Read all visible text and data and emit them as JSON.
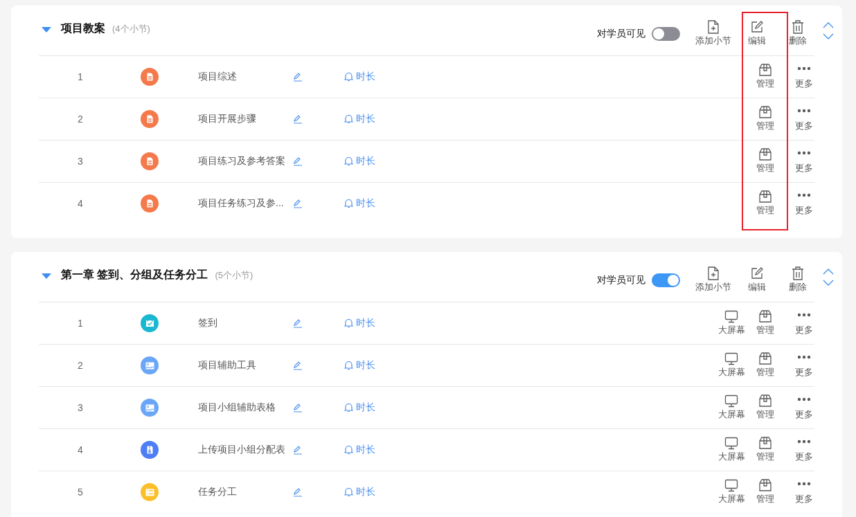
{
  "chapters": [
    {
      "title": "项目教案",
      "count": "(4个小节)",
      "expanded": true,
      "visibility_label": "对学员可见",
      "visible": false,
      "annotation_frame": {
        "color": "#e8212b"
      },
      "actions": [
        {
          "kind": "add",
          "label": "添加小节"
        },
        {
          "kind": "edit",
          "label": "编辑"
        },
        {
          "kind": "delete",
          "label": "删除"
        }
      ],
      "lessons": [
        {
          "number": "1",
          "kind": "document",
          "color": "#f57a4b",
          "title": "项目综述",
          "duration": "时长",
          "actions": [
            {
              "kind": "manage",
              "label": "管理"
            },
            {
              "kind": "more",
              "label": "更多"
            }
          ]
        },
        {
          "number": "2",
          "kind": "document",
          "color": "#f57a4b",
          "title": "项目开展步骤",
          "duration": "时长",
          "actions": [
            {
              "kind": "manage",
              "label": "管理"
            },
            {
              "kind": "more",
              "label": "更多"
            }
          ]
        },
        {
          "number": "3",
          "kind": "document",
          "color": "#f57a4b",
          "title": "项目练习及参考答案",
          "duration": "时长",
          "actions": [
            {
              "kind": "manage",
              "label": "管理"
            },
            {
              "kind": "more",
              "label": "更多"
            }
          ]
        },
        {
          "number": "4",
          "kind": "document",
          "color": "#f57a4b",
          "title": "项目任务练习及参...",
          "duration": "时长",
          "actions": [
            {
              "kind": "manage",
              "label": "管理"
            },
            {
              "kind": "more",
              "label": "更多"
            }
          ]
        }
      ]
    },
    {
      "title": "第一章 签到、分组及任务分工",
      "count": "(5个小节)",
      "expanded": true,
      "visibility_label": "对学员可见",
      "visible": true,
      "actions": [
        {
          "kind": "add",
          "label": "添加小节"
        },
        {
          "kind": "edit",
          "label": "编辑"
        },
        {
          "kind": "delete",
          "label": "删除"
        }
      ],
      "lessons": [
        {
          "number": "1",
          "kind": "checkin",
          "color": "#1ab8d0",
          "title": "签到",
          "duration": "时长",
          "actions": [
            {
              "kind": "screen",
              "label": "大屏幕"
            },
            {
              "kind": "manage",
              "label": "管理"
            },
            {
              "kind": "more",
              "label": "更多"
            }
          ]
        },
        {
          "number": "2",
          "kind": "image",
          "color": "#6aa6f8",
          "title": "项目辅助工具",
          "duration": "时长",
          "actions": [
            {
              "kind": "screen",
              "label": "大屏幕"
            },
            {
              "kind": "manage",
              "label": "管理"
            },
            {
              "kind": "more",
              "label": "更多"
            }
          ]
        },
        {
          "number": "3",
          "kind": "image",
          "color": "#6aa6f8",
          "title": "项目小组辅助表格",
          "duration": "时长",
          "actions": [
            {
              "kind": "screen",
              "label": "大屏幕"
            },
            {
              "kind": "manage",
              "label": "管理"
            },
            {
              "kind": "more",
              "label": "更多"
            }
          ]
        },
        {
          "number": "4",
          "kind": "archive",
          "color": "#4e7df5",
          "title": "上传项目小组分配表",
          "duration": "时长",
          "actions": [
            {
              "kind": "screen",
              "label": "大屏幕"
            },
            {
              "kind": "manage",
              "label": "管理"
            },
            {
              "kind": "more",
              "label": "更多"
            }
          ]
        },
        {
          "number": "5",
          "kind": "list",
          "color": "#fbbf2a",
          "title": "任务分工",
          "duration": "时长",
          "actions": [
            {
              "kind": "screen",
              "label": "大屏幕"
            },
            {
              "kind": "manage",
              "label": "管理"
            },
            {
              "kind": "more",
              "label": "更多"
            }
          ]
        }
      ]
    }
  ]
}
